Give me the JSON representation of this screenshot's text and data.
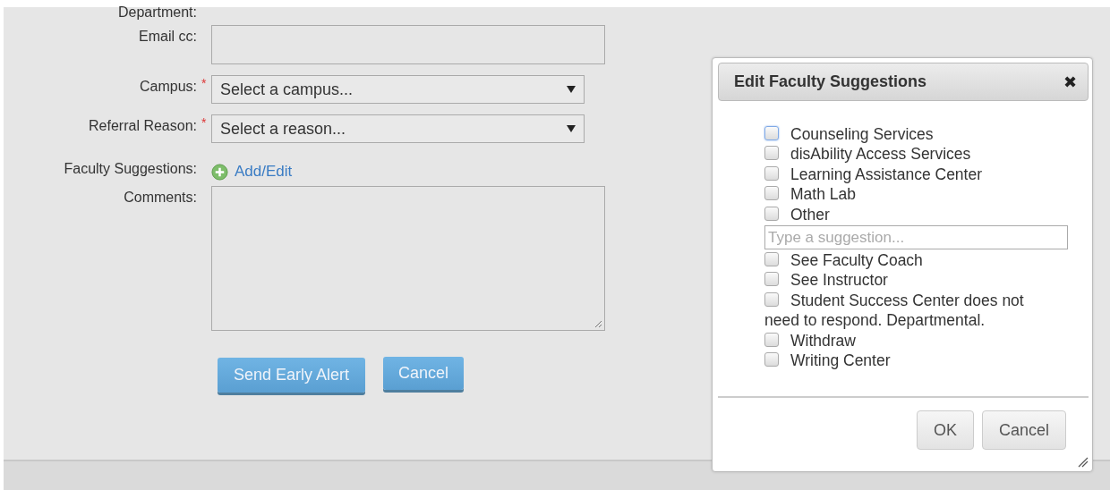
{
  "form": {
    "fields": [
      {
        "kind": "text",
        "label": "Department:"
      },
      {
        "kind": "textbox",
        "label": "Email cc:",
        "required": false
      },
      {
        "kind": "select",
        "label": "Campus:",
        "required": true,
        "value": "Select a campus..."
      },
      {
        "kind": "select",
        "label": "Referral Reason:",
        "required": true,
        "value": "Select a reason..."
      },
      {
        "kind": "link",
        "label": "Faculty Suggestions:",
        "link": "Add/Edit"
      },
      {
        "kind": "textarea",
        "label": "Comments:"
      }
    ],
    "required_mark": "*",
    "buttons": [
      "Send Early Alert",
      "Cancel"
    ]
  },
  "dialog": {
    "title": "Edit Faculty Suggestions",
    "close": "✖",
    "items": [
      {
        "kind": "checkbox",
        "label": "Counseling Services",
        "checked": false,
        "focused": true
      },
      {
        "kind": "checkbox",
        "label": "disAbility Access Services",
        "checked": false,
        "focused": false
      },
      {
        "kind": "checkbox",
        "label": "Learning Assistance Center",
        "checked": false,
        "focused": false
      },
      {
        "kind": "checkbox",
        "label": "Math Lab",
        "checked": false,
        "focused": false
      },
      {
        "kind": "checkbox",
        "label": "Other",
        "checked": false,
        "focused": false
      },
      {
        "kind": "input",
        "placeholder": "Type a suggestion..."
      },
      {
        "kind": "checkbox",
        "label": "See Faculty Coach",
        "checked": false,
        "focused": false
      },
      {
        "kind": "checkbox",
        "label": "See Instructor",
        "checked": false,
        "focused": false
      },
      {
        "kind": "checkbox",
        "label": "Student Success Center does not need to respond. Departmental.",
        "checked": false,
        "focused": false
      },
      {
        "kind": "checkbox",
        "label": "Withdraw",
        "checked": false,
        "focused": false
      },
      {
        "kind": "checkbox",
        "label": "Writing Center",
        "checked": false,
        "focused": false
      }
    ],
    "buttons": [
      "OK",
      "Cancel"
    ]
  }
}
